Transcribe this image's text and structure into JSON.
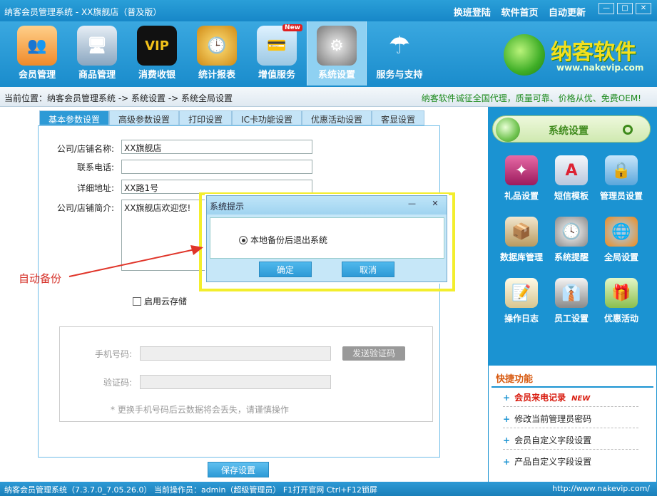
{
  "window": {
    "title": "纳客会员管理系统 - XX旗舰店（普及版）",
    "links": [
      "换班登陆",
      "软件首页",
      "自动更新"
    ]
  },
  "toolbar": {
    "items": [
      {
        "label": "会员管理",
        "icon": "people-icon"
      },
      {
        "label": "商品管理",
        "icon": "monitor-icon"
      },
      {
        "label": "消费收银",
        "icon": "vip-icon"
      },
      {
        "label": "统计报表",
        "icon": "clock-globe-icon"
      },
      {
        "label": "增值服务",
        "icon": "card-money-icon",
        "badge": "New"
      },
      {
        "label": "系统设置",
        "icon": "gear-icon"
      },
      {
        "label": "服务与支持",
        "icon": "umbrella-icon"
      }
    ]
  },
  "brand": {
    "name": "纳客软件",
    "url": "www.nakevip.com"
  },
  "breadcrumb": "当前位置：纳客会员管理系统 -> 系统设置 -> 系统全局设置",
  "promo": "纳客软件诚征全国代理，质量可靠、价格从优、免费OEM!",
  "tabs": [
    "基本参数设置",
    "高级参数设置",
    "打印设置",
    "IC卡功能设置",
    "优惠活动设置",
    "客显设置"
  ],
  "form": {
    "company_label": "公司/店铺名称:",
    "company_value": "XX旗舰店",
    "phone_label": "联系电话:",
    "phone_value": "",
    "address_label": "详细地址:",
    "address_value": "XX路1号",
    "intro_label": "公司/店铺简介:",
    "intro_value": "XX旗舰店欢迎您!",
    "cloud_label": "启用云存储",
    "mobile_label": "手机号码:",
    "send_code": "发送验证码",
    "code_label": "验证码:",
    "notice": "* 更换手机号码后云数据将会丢失，请谨慎操作",
    "save": "保存设置"
  },
  "sidebar": {
    "title": "系统设置",
    "items": [
      {
        "label": "礼品设置",
        "icon": "gift-icon"
      },
      {
        "label": "短信模板",
        "icon": "sms-icon"
      },
      {
        "label": "管理员设置",
        "icon": "admin-icon"
      },
      {
        "label": "数据库管理",
        "icon": "database-icon"
      },
      {
        "label": "系统提醒",
        "icon": "alarm-icon"
      },
      {
        "label": "全局设置",
        "icon": "globe-icon"
      },
      {
        "label": "操作日志",
        "icon": "log-icon"
      },
      {
        "label": "员工设置",
        "icon": "employee-icon"
      },
      {
        "label": "优惠活动",
        "icon": "promotion-icon"
      }
    ]
  },
  "quick": {
    "title": "快捷功能",
    "items": [
      "会员来电记录",
      "修改当前管理员密码",
      "会员自定义字段设置",
      "产品自定义字段设置"
    ],
    "new_badge": "NEW"
  },
  "dialog": {
    "title": "系统提示",
    "option": "本地备份后退出系统",
    "ok": "确定",
    "cancel": "取消"
  },
  "annotation": "自动备份",
  "status": {
    "left": "纳客会员管理系统（7.3.7.0_7.05.26.0） 当前操作员：admin（超级管理员） F1打开官网 Ctrl+F12锁屏",
    "right": "http://www.nakevip.com/"
  }
}
